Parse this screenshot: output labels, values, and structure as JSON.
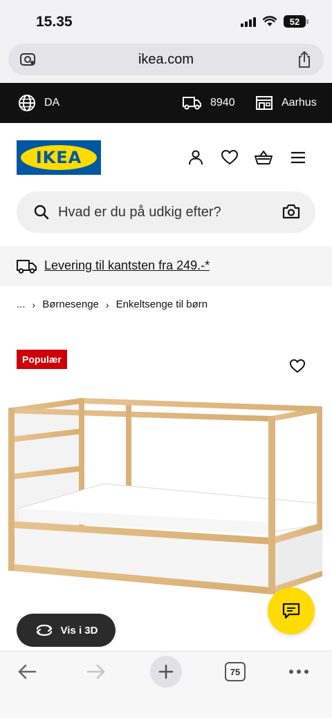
{
  "status": {
    "time": "15.35",
    "battery": "52"
  },
  "browser": {
    "url": "ikea.com"
  },
  "locale_bar": {
    "language": "DA",
    "postal_code": "8940",
    "store": "Aarhus"
  },
  "header": {
    "logo_text": "IKEA",
    "brand_blue": "#0058a3",
    "brand_yellow": "#ffdb00"
  },
  "search": {
    "placeholder": "Hvad er du på udkig efter?"
  },
  "delivery": {
    "text": "Levering til kantsten fra 249.-*"
  },
  "breadcrumb": {
    "ellipsis": "...",
    "items": [
      "Børnesenge",
      "Enkeltsenge til børn"
    ]
  },
  "product": {
    "badge": "Populær",
    "badge_color": "#cc0008"
  },
  "actions": {
    "view_3d": "Vis i 3D"
  },
  "toolbar": {
    "tab_count": "75"
  },
  "icons": [
    "globe-icon",
    "truck-icon",
    "store-icon",
    "person-icon",
    "heart-icon",
    "basket-icon",
    "menu-icon",
    "search-icon",
    "camera-icon",
    "chat-icon",
    "rotate-3d-icon",
    "back-arrow-icon",
    "forward-arrow-icon",
    "plus-icon",
    "more-icon"
  ]
}
